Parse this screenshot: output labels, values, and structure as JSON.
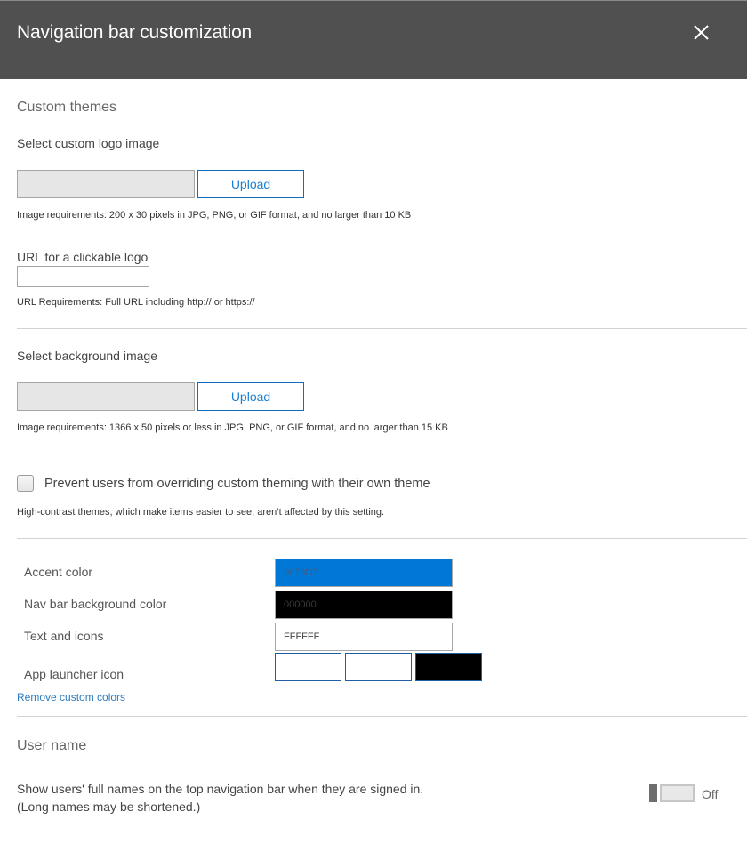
{
  "header": {
    "title": "Navigation bar customization",
    "close_icon": "close-icon"
  },
  "custom_themes": {
    "title": "Custom themes",
    "logo": {
      "label": "Select custom logo image",
      "file_value": "",
      "upload_label": "Upload",
      "requirements": "Image requirements: 200 x 30 pixels in JPG, PNG, or GIF format, and no larger than 10 KB"
    },
    "logo_url": {
      "label": "URL for a clickable logo",
      "value": "",
      "requirements": "URL Requirements: Full URL including http:// or https://"
    },
    "background": {
      "label": "Select background image",
      "file_value": "",
      "upload_label": "Upload",
      "requirements": "Image requirements: 1366 x 50 pixels or less in JPG, PNG, or GIF format, and no larger than 15 KB"
    },
    "prevent_override": {
      "label": "Prevent users from overriding custom theming with their own theme",
      "checked": false,
      "note": "High-contrast themes, which make items easier to see, aren’t affected by this setting."
    }
  },
  "colors": {
    "accent": {
      "label": "Accent color",
      "value": "0078D7",
      "swatch": "#0078D7"
    },
    "nav_bg": {
      "label": "Nav bar background color",
      "value": "000000",
      "swatch": "#000000"
    },
    "text_icons": {
      "label": "Text and icons",
      "value": "FFFFFF",
      "swatch": "#FFFFFF"
    },
    "app_launcher": {
      "label": "App launcher icon",
      "options": [
        "#FFFFFF",
        "#FFFFFF",
        "#000000"
      ]
    },
    "remove_link": "Remove custom colors"
  },
  "user_name": {
    "title": "User name",
    "description_line1": "Show users' full names on the top navigation bar when they are signed in.",
    "description_line2": "(Long names may be shortened.)",
    "toggle_state": "Off",
    "toggle_on": false
  }
}
